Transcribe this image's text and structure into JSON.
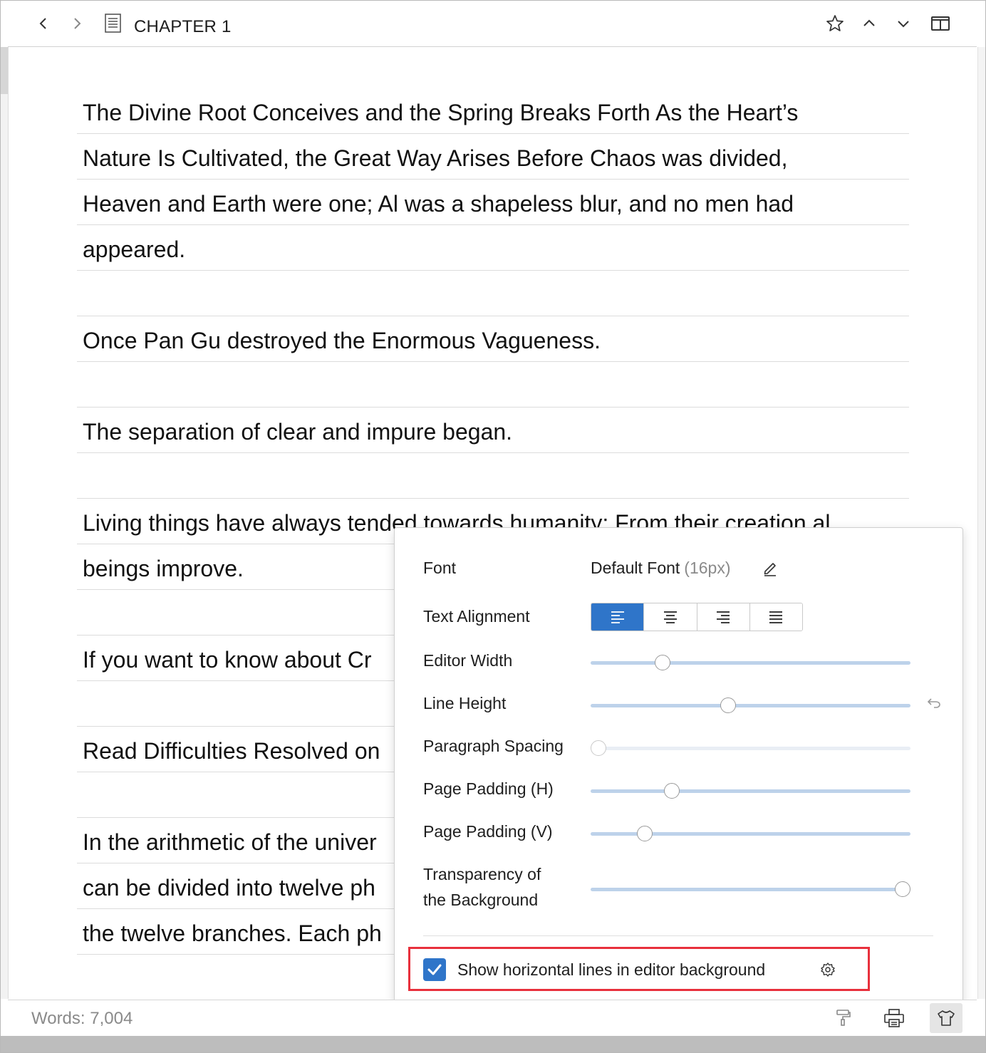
{
  "toolbar": {
    "chapter_title": "CHAPTER 1",
    "icons": [
      "chevron-left-icon",
      "chevron-right-icon",
      "document-icon",
      "star-icon",
      "chevron-up-icon",
      "chevron-down-icon",
      "split-view-icon"
    ]
  },
  "editor": {
    "lines": [
      "The Divine Root Conceives and the Spring Breaks Forth As the Heart’s",
      "Nature Is Cultivated, the Great Way Arises Before Chaos was divided,",
      "Heaven and Earth were one; Al was a shapeless blur, and no men had",
      "appeared.",
      "",
      "Once Pan Gu destroyed the Enormous Vagueness.",
      "",
      "The separation of clear and impure began.",
      "",
      "Living things have always tended towards humanity; From their creation al",
      "beings improve.",
      "",
      "If you want to know about Cr",
      "",
      "Read Difficulties Resolved on",
      "",
      "In the arithmetic of the univer",
      "can be divided into twelve ph",
      "the twelve branches. Each ph"
    ]
  },
  "settings": {
    "font_label": "Font",
    "font_value": "Default Font",
    "font_size": "(16px)",
    "text_alignment_label": "Text Alignment",
    "alignment_options": [
      "align-left",
      "align-center",
      "align-right",
      "align-justify"
    ],
    "alignment_selected": "align-left",
    "editor_width_label": "Editor Width",
    "editor_width_value": 0.225,
    "line_height_label": "Line Height",
    "line_height_value": 0.43,
    "paragraph_spacing_label": "Paragraph Spacing",
    "paragraph_spacing_value": 0.025,
    "page_padding_h_label": "Page Padding (H)",
    "page_padding_h_value": 0.253,
    "page_padding_v_label": "Page Padding (V)",
    "page_padding_v_value": 0.169,
    "transparency_label_1": "Transparency of",
    "transparency_label_2": "the Background",
    "transparency_value": 0.975,
    "show_lines_label": "Show horizontal lines in editor background",
    "show_lines_checked": true
  },
  "status": {
    "words": "Words: 7,004"
  },
  "colors": {
    "accent": "#2f75c9",
    "highlight_box": "#e8303c",
    "slider_track": "#bdd2ea"
  }
}
